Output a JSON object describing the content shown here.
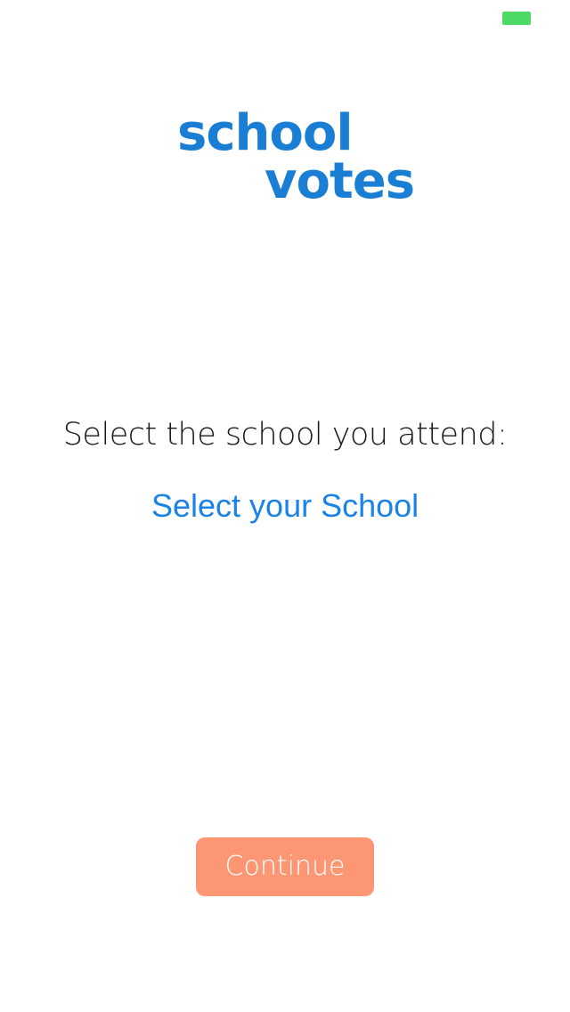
{
  "colors": {
    "background": "#ffffff",
    "brand_blue": "#1a7fd4",
    "link_blue": "#1b82e6",
    "text_dark": "#1a1a1a",
    "button_orange": "#fc9673",
    "button_text": "#ffffff",
    "battery_green": "#4cd964"
  },
  "status_bar": {
    "battery_icon": "battery-icon"
  },
  "logo": {
    "line1": "school",
    "line2": "votes"
  },
  "prompt": {
    "text": "Select the school you attend:"
  },
  "school_picker": {
    "label": "Select your School"
  },
  "continue_button": {
    "label": "Continue"
  }
}
